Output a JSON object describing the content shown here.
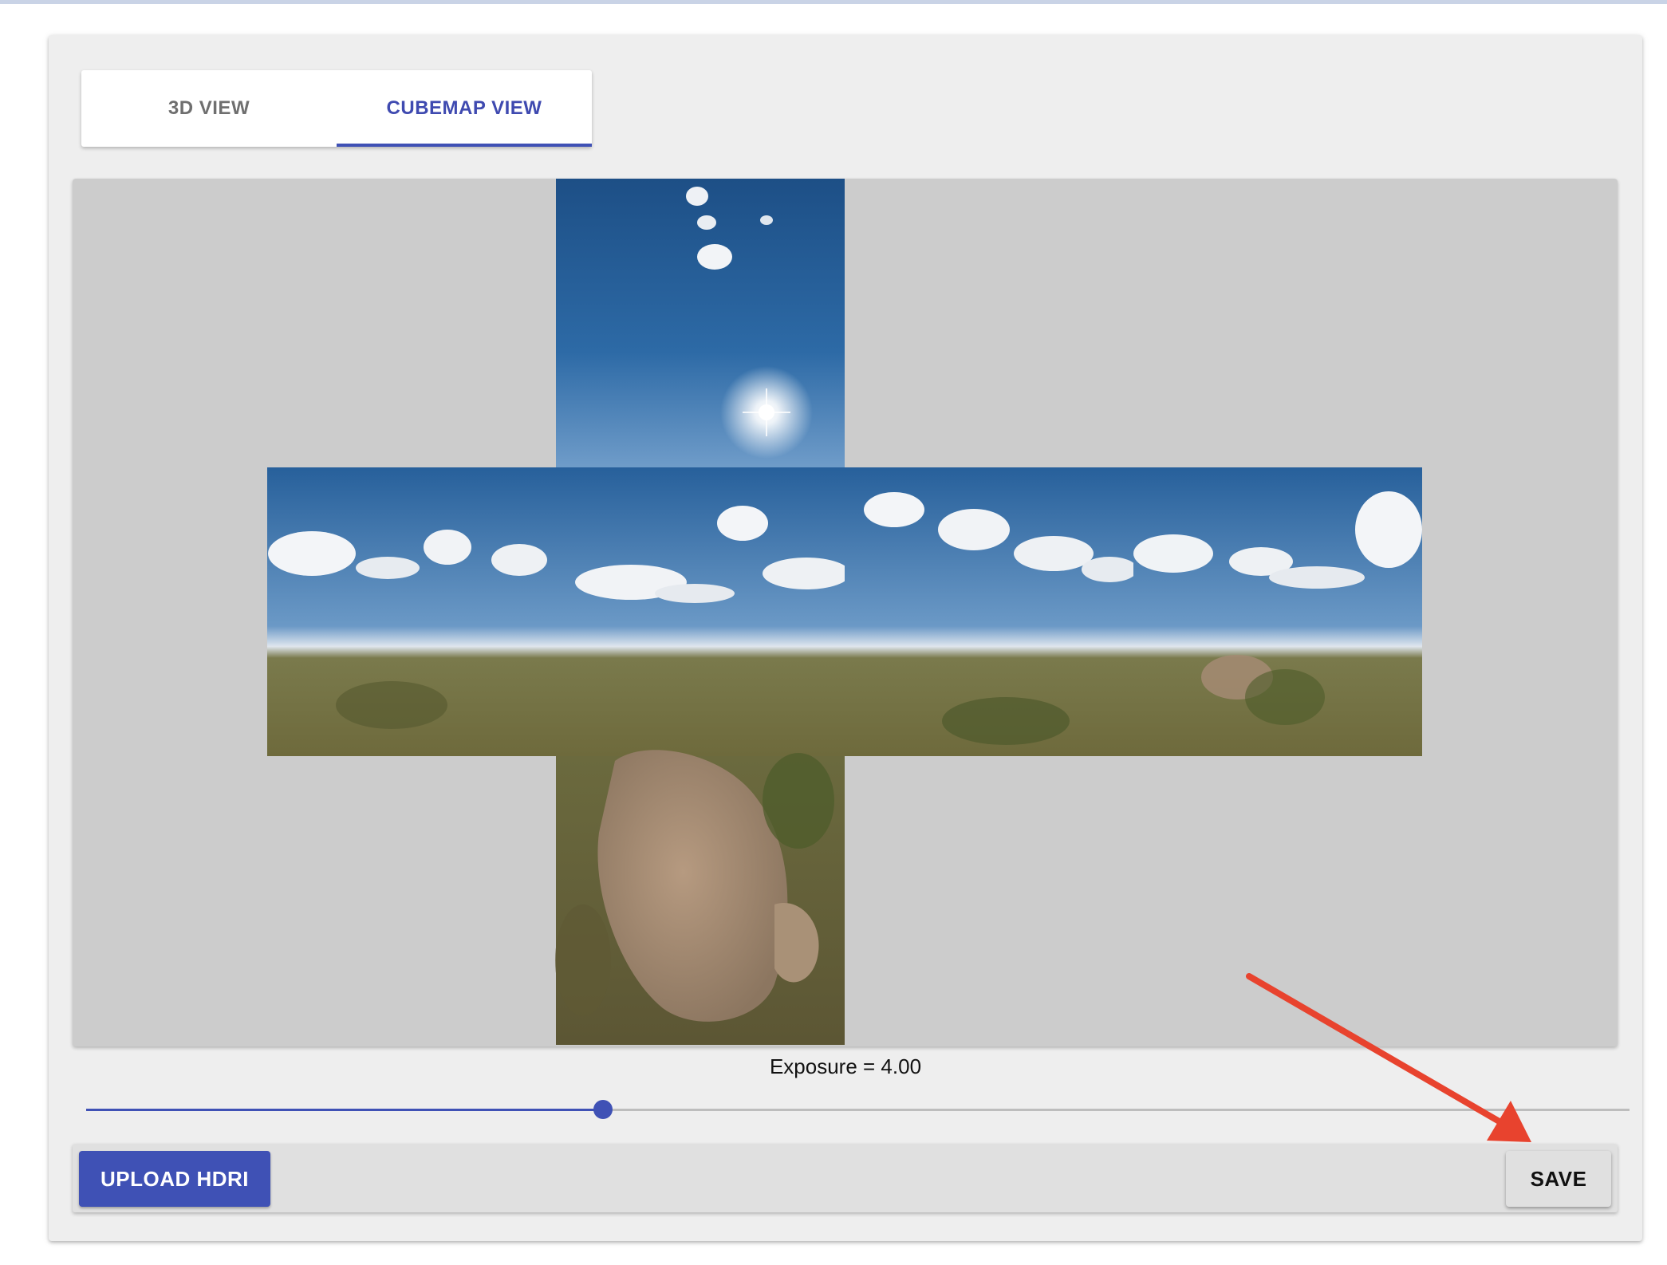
{
  "tabs": [
    {
      "label": "3D VIEW",
      "active": false
    },
    {
      "label": "CUBEMAP VIEW",
      "active": true
    }
  ],
  "exposure": {
    "label": "Exposure = 4.00",
    "slider_fraction": 0.335
  },
  "toolbar": {
    "upload_label": "UPLOAD HDRI",
    "save_label": "SAVE"
  },
  "colors": {
    "accent": "#3f51b5",
    "annotation_arrow": "#e8432e",
    "viewer_background": "#cccccc"
  },
  "cubemap": {
    "layout": "cross",
    "faces": [
      "top-sky",
      "left",
      "front",
      "right",
      "back",
      "bottom-ground"
    ]
  }
}
